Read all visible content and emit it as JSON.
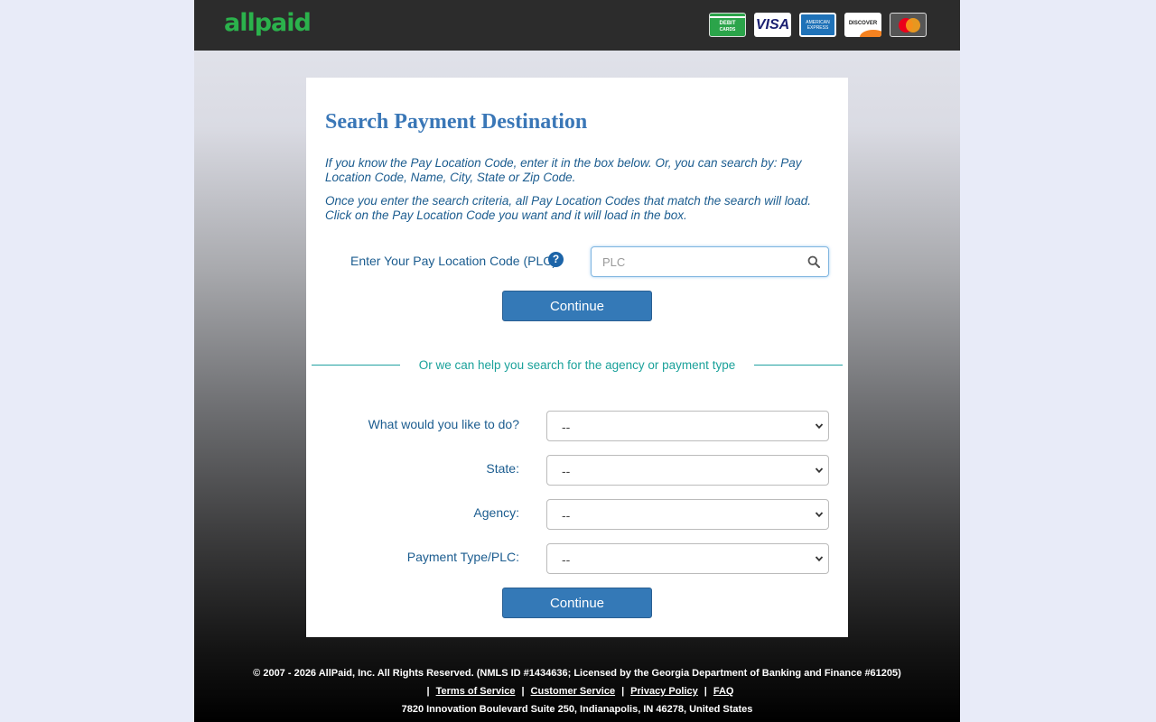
{
  "header": {
    "logo": "allpaid",
    "cards": {
      "debit_line1": "DEBIT",
      "debit_line2": "CARDS",
      "visa": "VISA",
      "amex_line1": "AMERICAN",
      "amex_line2": "EXPRESS",
      "discover": "DISCOVER"
    }
  },
  "panel": {
    "title": "Search Payment Destination",
    "intro1": "If you know the Pay Location Code, enter it in the box below. Or, you can search by: Pay Location Code, Name, City, State or Zip Code.",
    "intro2": "Once you enter the search criteria, all Pay Location Codes that match the search will load. Click on the Pay Location Code you want and it will load in the box.",
    "plc_label": "Enter Your Pay Location Code (PLC):",
    "help_glyph": "?",
    "plc_placeholder": "PLC",
    "continue_label": "Continue",
    "divider_text": "Or we can help you search for the agency or payment type",
    "rows": [
      {
        "label": "What would you like to do?",
        "value": "--"
      },
      {
        "label": "State:",
        "value": "--"
      },
      {
        "label": "Agency:",
        "value": "--"
      },
      {
        "label": "Payment Type/PLC:",
        "value": "--"
      }
    ],
    "continue2_label": "Continue"
  },
  "footer": {
    "copyright": "© 2007 - 2026 AllPaid, Inc. All Rights Reserved. (NMLS ID #1434636; Licensed by the Georgia Department of Banking and Finance #61205)",
    "links": [
      "Terms of Service",
      "Customer Service",
      "Privacy Policy",
      "FAQ"
    ],
    "separator": "|",
    "address": "7820 Innovation Boulevard Suite 250, Indianapolis, IN 46278, United States"
  },
  "colors": {
    "logo_green": "#2bb24c",
    "title_blue": "#3a77b7",
    "text_blue": "#1b5c8f",
    "button_blue": "#3479b7",
    "divider_teal": "#1aa19a"
  }
}
